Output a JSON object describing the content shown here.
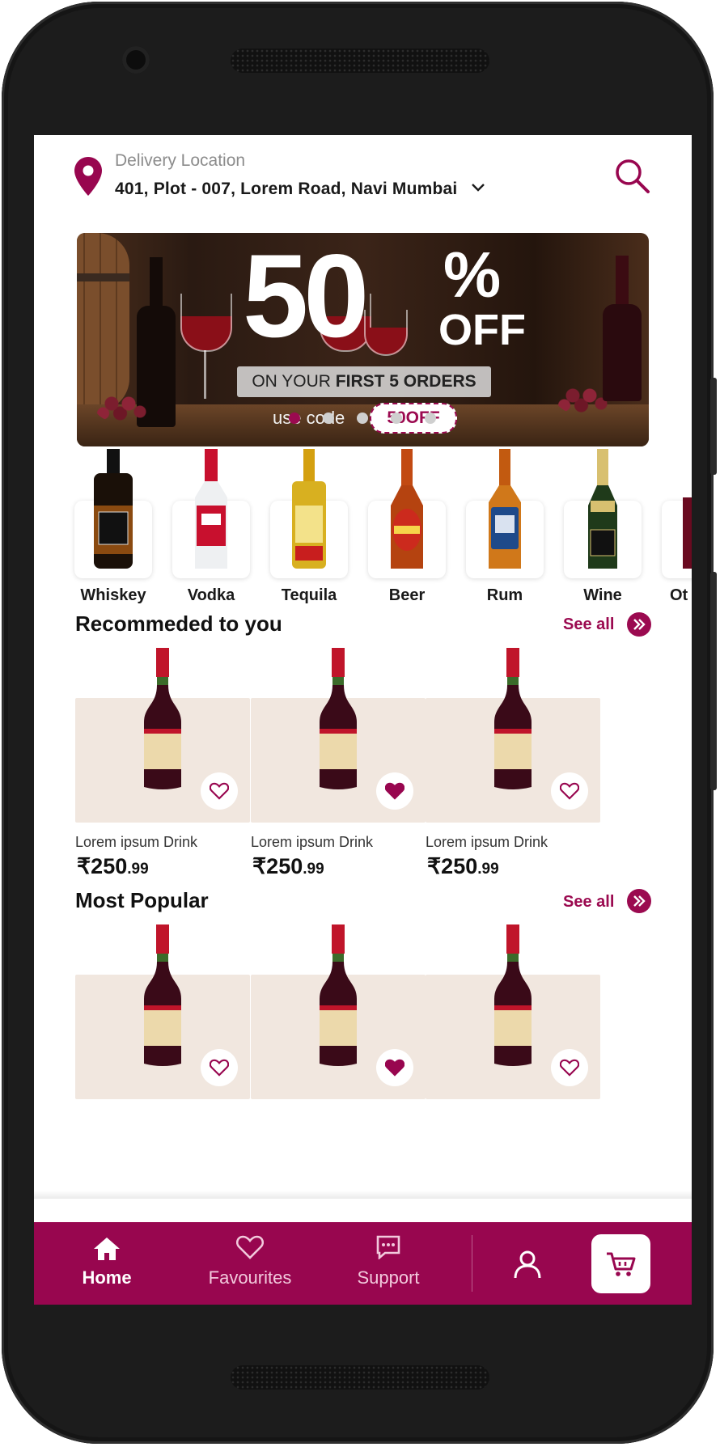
{
  "header": {
    "location_label": "Delivery Location",
    "address": "401, Plot - 007, Lorem Road, Navi Mumbai"
  },
  "banner": {
    "big_number": "50",
    "percent": "%",
    "off": "OFF",
    "strip_prefix": "ON YOUR ",
    "strip_bold": "FIRST 5 ORDERS",
    "use_code": "use code",
    "code": "50OFF"
  },
  "carousel": {
    "total": 5,
    "active": 1
  },
  "categories": [
    {
      "label": "Whiskey"
    },
    {
      "label": "Vodka"
    },
    {
      "label": "Tequila"
    },
    {
      "label": "Beer"
    },
    {
      "label": "Rum"
    },
    {
      "label": "Wine"
    },
    {
      "label": "Ot"
    }
  ],
  "recommended": {
    "title": "Recommeded to you",
    "see_all": "See all",
    "items": [
      {
        "name": "Lorem ipsum Drink",
        "price_main": "₹250",
        "price_dec": ".99",
        "favourite": false
      },
      {
        "name": "Lorem ipsum Drink",
        "price_main": "₹250",
        "price_dec": ".99",
        "favourite": true
      },
      {
        "name": "Lorem ipsum Drink",
        "price_main": "₹250",
        "price_dec": ".99",
        "favourite": false
      }
    ]
  },
  "popular": {
    "title": "Most Popular",
    "see_all": "See all",
    "items": [
      {
        "favourite": false
      },
      {
        "favourite": true
      },
      {
        "favourite": false
      }
    ]
  },
  "nav": {
    "home": "Home",
    "favourites": "Favourites",
    "support": "Support"
  },
  "colors": {
    "accent": "#98064f",
    "card_bg": "#f1e7df"
  }
}
